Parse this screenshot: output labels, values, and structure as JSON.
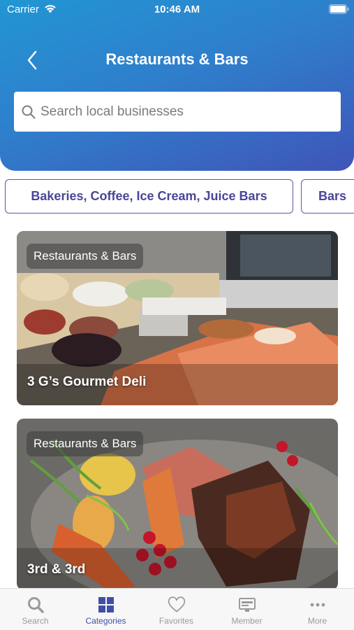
{
  "status_bar": {
    "carrier": "Carrier",
    "time": "10:46 AM"
  },
  "header": {
    "title": "Restaurants & Bars"
  },
  "search": {
    "placeholder": "Search local businesses",
    "value": ""
  },
  "categories": [
    {
      "label": "Bakeries, Coffee, Ice Cream, Juice Bars"
    },
    {
      "label": "Bars"
    }
  ],
  "listings": [
    {
      "tag": "Restaurants & Bars",
      "name": "3 G’s Gourmet Deli"
    },
    {
      "tag": "Restaurants & Bars",
      "name": "3rd & 3rd"
    }
  ],
  "tabs": [
    {
      "label": "Search",
      "icon": "search-icon",
      "active": false
    },
    {
      "label": "Categories",
      "icon": "grid-icon",
      "active": true
    },
    {
      "label": "Favorites",
      "icon": "heart-icon",
      "active": false
    },
    {
      "label": "Member",
      "icon": "member-card-icon",
      "active": false
    },
    {
      "label": "More",
      "icon": "more-icon",
      "active": false
    }
  ],
  "colors": {
    "accent": "#3f4fa8",
    "chip_text": "#4a4599",
    "header_start": "#2196d3",
    "header_end": "#3f55b8"
  }
}
